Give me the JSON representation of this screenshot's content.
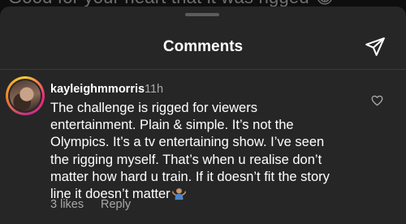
{
  "background": {
    "partial_text": "Good for your heart that it was rigged 😂"
  },
  "header": {
    "title": "Comments",
    "send_icon": "send-icon"
  },
  "comment": {
    "username": "kayleighmmorris",
    "timestamp": "11h",
    "lines": [
      "The challenge is rigged for viewers",
      "entertainment. Plain & simple. It’s not the",
      "Olympics. It’s a tv entertaining show. I’ve seen",
      "the rigging myself. That’s when u realise don’t",
      "matter how hard u train. If it doesn’t fit the story",
      "line it doesn’t matter"
    ],
    "emoji": "man-shrugging-emoji",
    "likes": "3 likes",
    "reply": "Reply",
    "like_icon": "heart-outline-icon"
  },
  "colors": {
    "background": "#0e0e0e",
    "sheet": "#262626",
    "text_primary": "#ffffff",
    "text_secondary": "#a8a8a8",
    "divider": "#3a3a3a"
  }
}
